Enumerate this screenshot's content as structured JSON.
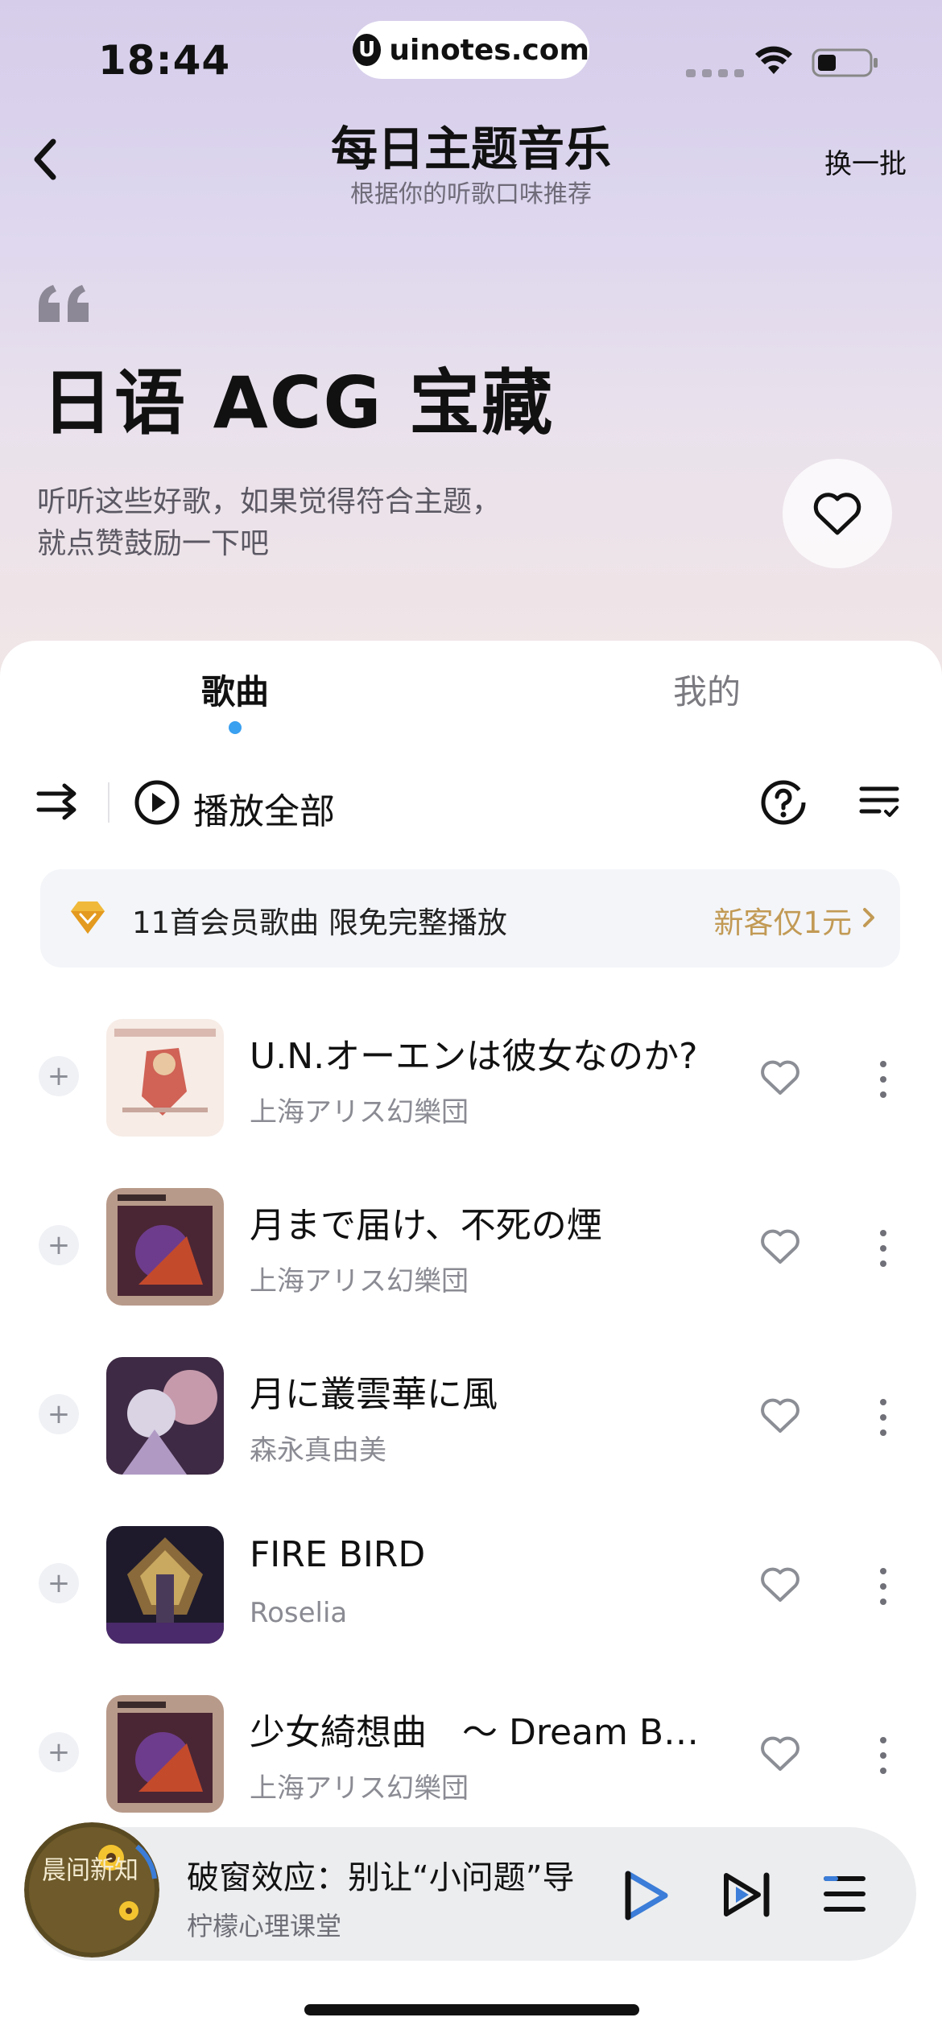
{
  "status_bar": {
    "time": "18:44",
    "url": "uinotes.com",
    "url_logo": "U"
  },
  "nav": {
    "title": "每日主题音乐",
    "subtitle": "根据你的听歌口味推荐",
    "action": "换一批"
  },
  "theme": {
    "title": "日语 ACG 宝藏",
    "desc_line1": "听听这些好歌，如果觉得符合主题，",
    "desc_line2": "就点赞鼓励一下吧"
  },
  "tabs": [
    {
      "label": "歌曲",
      "active": true
    },
    {
      "label": "我的",
      "active": false
    }
  ],
  "toolbar": {
    "play_all": "播放全部"
  },
  "vip_banner": {
    "text": "11首会员歌曲 限免完整播放",
    "cta": "新客仅1元"
  },
  "songs": [
    {
      "title": "U.N.オーエンは彼女なのか?",
      "artist": "上海アリス幻樂団",
      "cover": "#f3e6e0"
    },
    {
      "title": "月まで届け、不死の煙",
      "artist": "上海アリス幻樂団",
      "cover": "#5a2a3a"
    },
    {
      "title": "月に叢雲華に風",
      "artist": "森永真由美",
      "cover": "#7a5a78"
    },
    {
      "title": "FIRE BIRD",
      "artist": "Roselia",
      "cover": "#2e2638"
    },
    {
      "title": "少女綺想曲　～ Dream B…",
      "artist": "上海アリス幻樂団",
      "cover": "#5a2a3a"
    }
  ],
  "mini_player": {
    "title": "破窗效应：别让“小问题”导",
    "subtitle": "柠檬心理课堂",
    "cover_text": "晨间新知"
  },
  "colors": {
    "accent_blue": "#3aa0f0",
    "vip_gold": "#c29a55",
    "play_blue": "#3b7dd8"
  }
}
